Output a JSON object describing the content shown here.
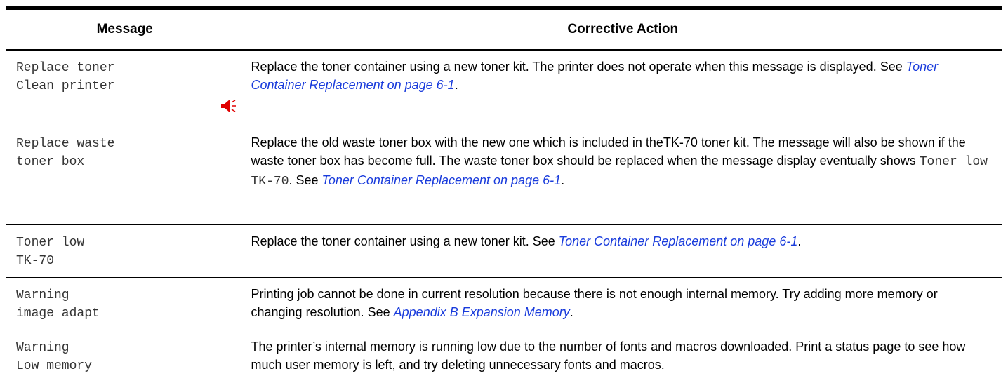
{
  "table": {
    "header_message": "Message",
    "header_action": "Corrective Action",
    "rows": [
      {
        "message": "Replace toner\nClean printer",
        "action_text": "Replace the toner container using a new toner kit. The printer does not operate when this message is displayed. See ",
        "action_link": "Toner Container Replacement on page 6-1",
        "action_end": ".",
        "alarm_icon": "speaker-alarm-icon"
      },
      {
        "message": "Replace waste\ntoner box",
        "action_text": "Replace the old waste toner box with the new one which is included in theTK-70 toner kit. The message will also be shown if the waste toner box has become full. The waste toner box should be replaced when the message display eventually shows ",
        "action_code": "Toner low TK-70",
        "action_mid": ". See ",
        "action_link": "Toner Container Replacement on page 6-1",
        "action_end": "."
      },
      {
        "message": "Toner low\nTK-70",
        "action_text": "Replace the toner container using a new toner kit. See ",
        "action_link": "Toner Container Replacement on page 6-1",
        "action_end": "."
      },
      {
        "message": "Warning\nimage adapt",
        "action_text": "Printing job cannot be done in current resolution because there is not enough internal memory. Try adding more memory or changing resolution. See ",
        "action_link": "Appendix B Expansion Memory",
        "action_end": "."
      },
      {
        "message": "Warning\nLow memory",
        "action_text": "The printer’s internal memory is running low due to the number of fonts and macros downloaded. Print a status page to see how much user memory is left, and try deleting unnecessary fonts and macros."
      }
    ]
  },
  "colors": {
    "link": "#1a3cdc",
    "alarm_icon": "#e00000",
    "rule": "#000000"
  }
}
